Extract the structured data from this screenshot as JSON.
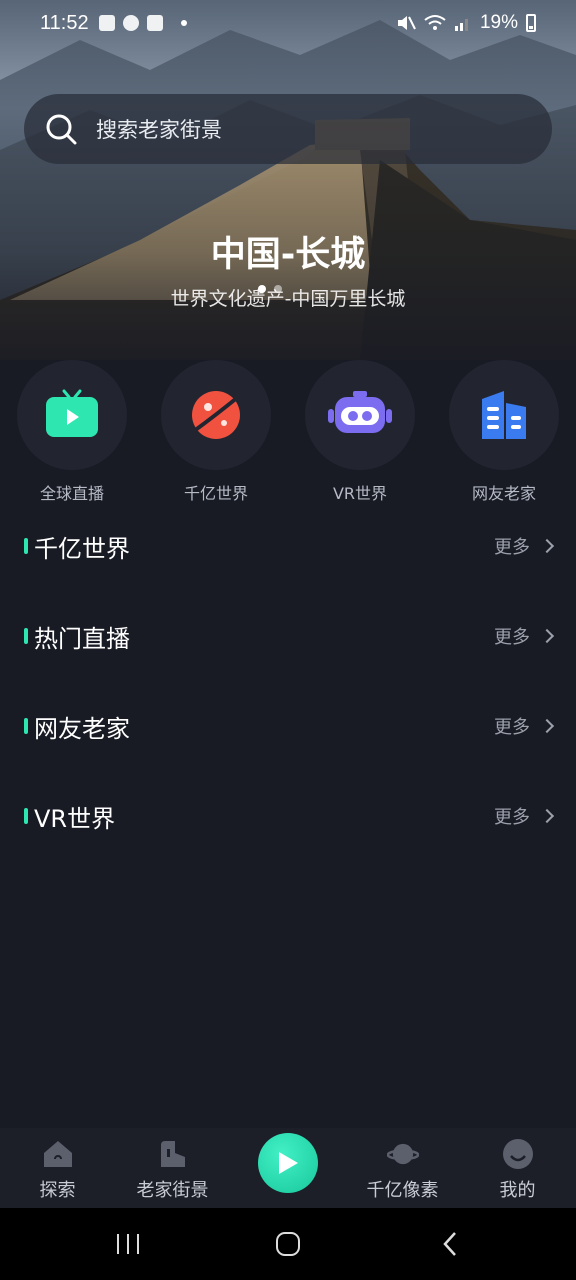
{
  "status_bar": {
    "time": "11:52",
    "battery": "19%"
  },
  "search": {
    "placeholder": "搜索老家街景"
  },
  "hero": {
    "title": "中国-长城",
    "subtitle": "世界文化遗产-中国万里长城"
  },
  "shortcuts": [
    {
      "label": "全球直播",
      "icon": "tv-play-icon",
      "color": "#2ee6b0"
    },
    {
      "label": "千亿世界",
      "icon": "planet-icon",
      "color": "#f0523f"
    },
    {
      "label": "VR世界",
      "icon": "vr-headset-icon",
      "color": "#7b6cf0"
    },
    {
      "label": "网友老家",
      "icon": "buildings-icon",
      "color": "#3b7bf0"
    }
  ],
  "sections": [
    {
      "title": "千亿世界",
      "more": "更多"
    },
    {
      "title": "热门直播",
      "more": "更多"
    },
    {
      "title": "网友老家",
      "more": "更多"
    },
    {
      "title": "VR世界",
      "more": "更多"
    }
  ],
  "tabs": [
    {
      "label": "探索",
      "icon": "home-icon"
    },
    {
      "label": "老家街景",
      "icon": "street-icon"
    },
    {
      "label": "千亿像素",
      "icon": "planet-icon"
    },
    {
      "label": "我的",
      "icon": "profile-icon"
    }
  ],
  "accent_color": "#2ee6b0"
}
